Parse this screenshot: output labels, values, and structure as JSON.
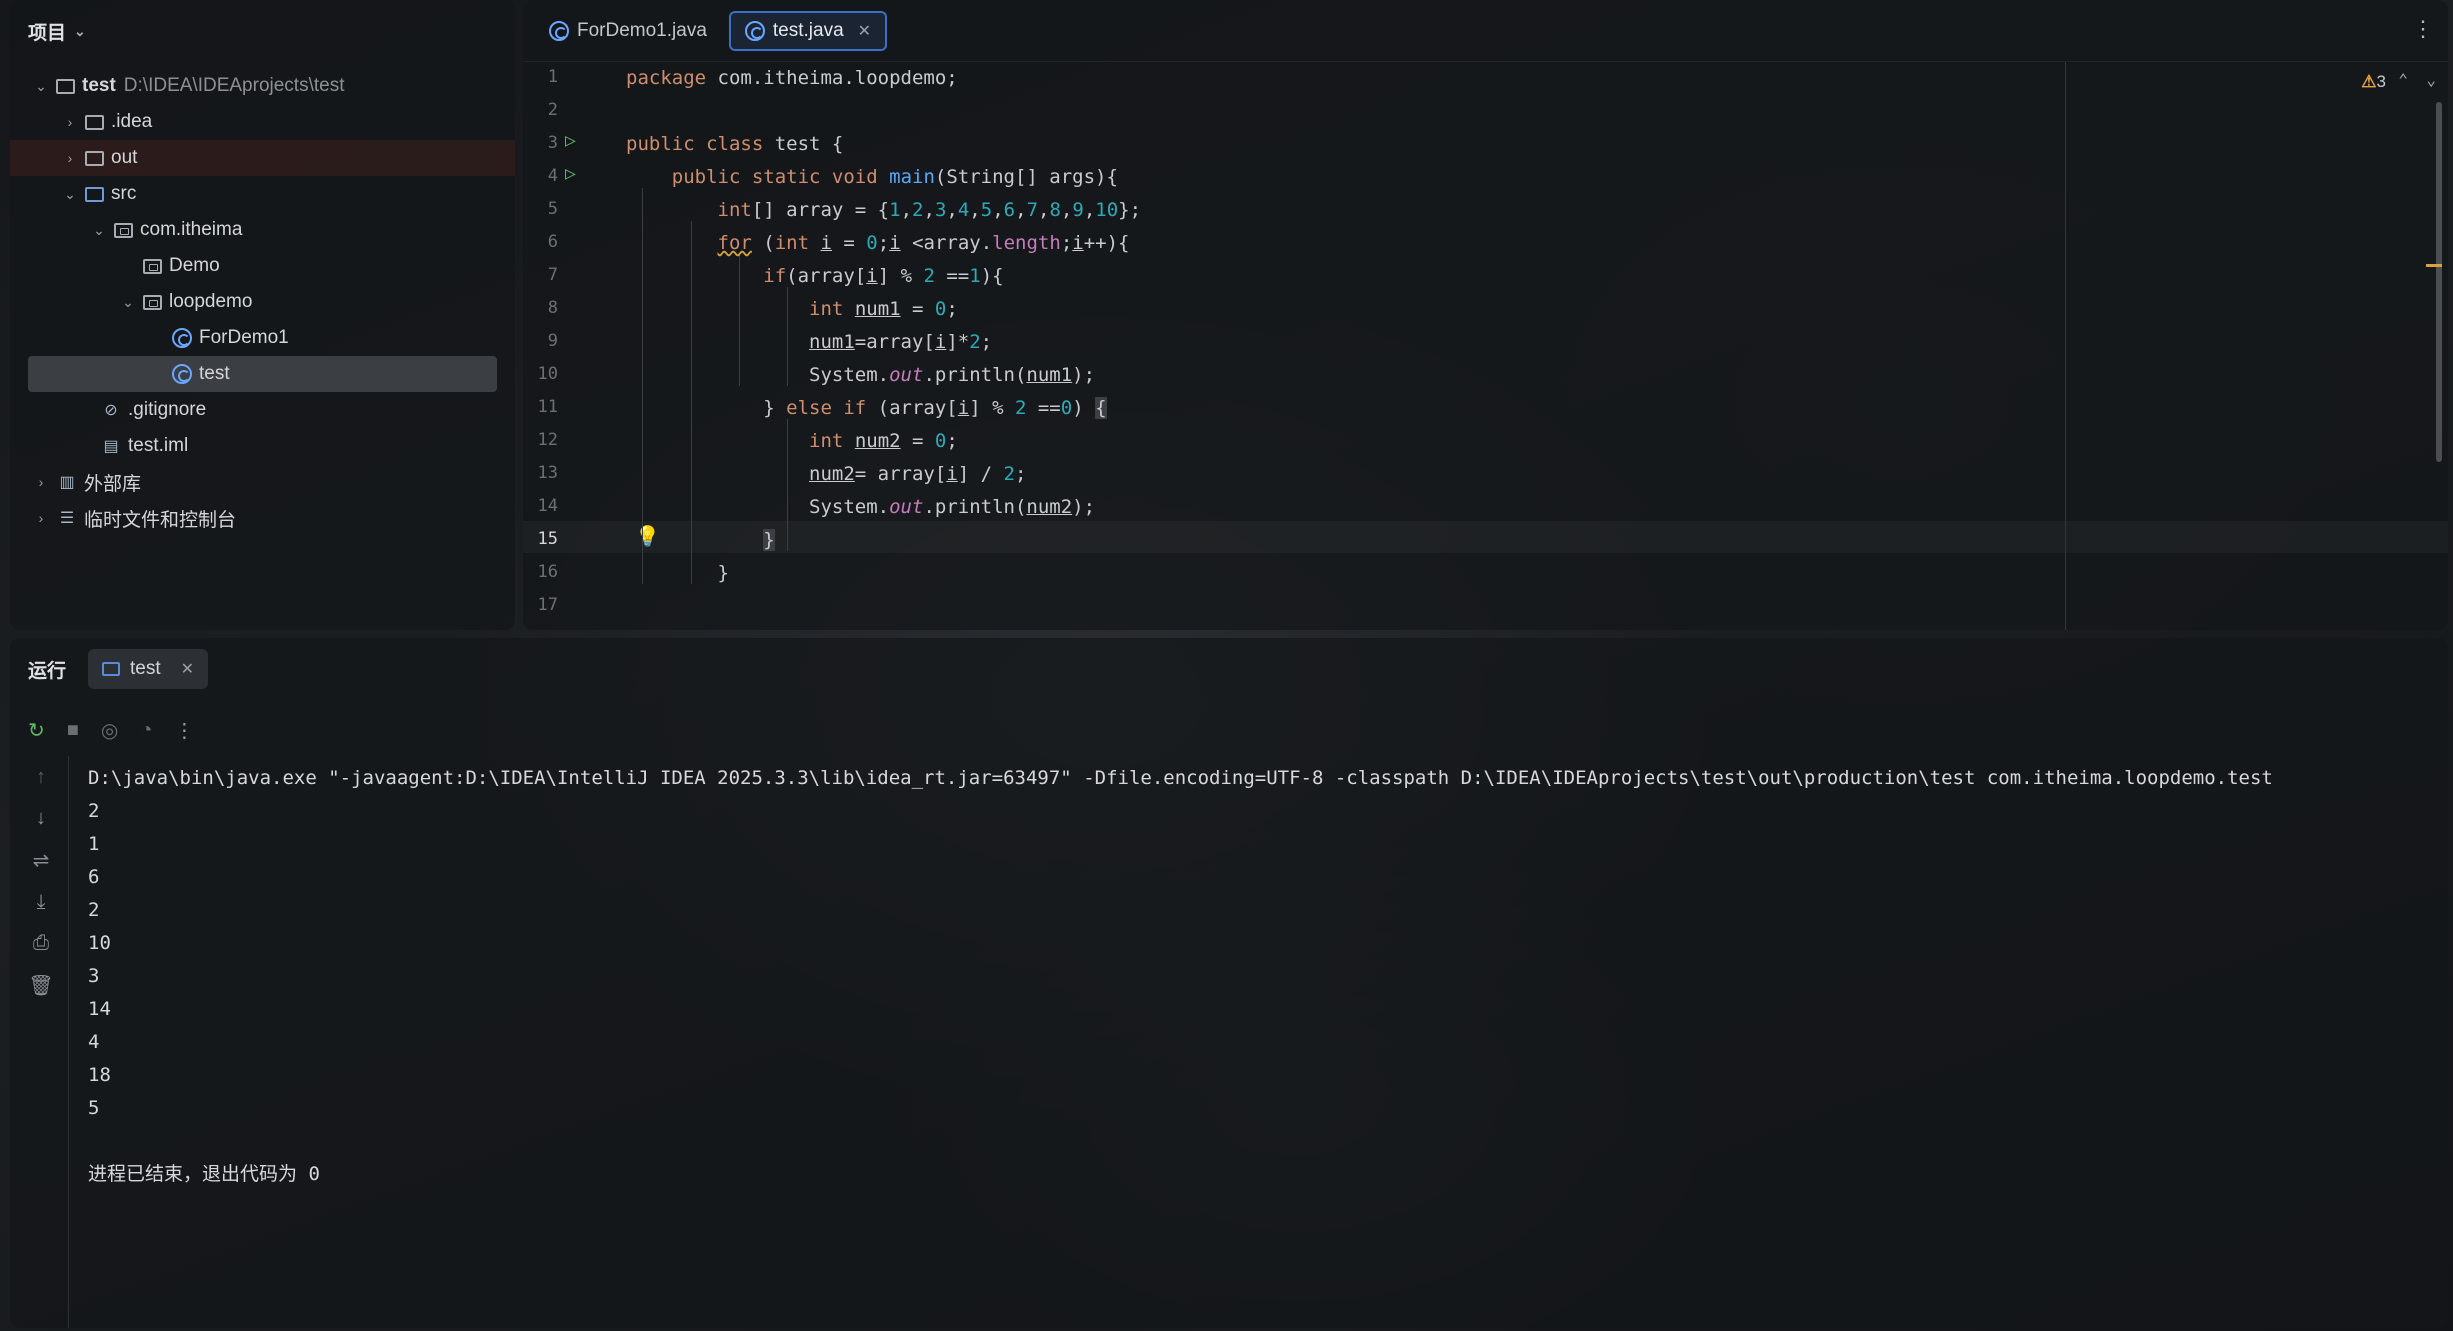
{
  "project": {
    "header": "项目",
    "tree": [
      {
        "label": "test",
        "path": "D:\\IDEA\\IDEAprojects\\test",
        "level": 0,
        "chevron": "down",
        "icon": "module-folder-icon"
      },
      {
        "label": ".idea",
        "level": 1,
        "chevron": "right",
        "icon": "folder-icon"
      },
      {
        "label": "out",
        "level": 1,
        "chevron": "right",
        "icon": "folder-icon"
      },
      {
        "label": "src",
        "level": 1,
        "chevron": "down",
        "icon": "source-folder-icon"
      },
      {
        "label": "com.itheima",
        "level": 2,
        "chevron": "down",
        "icon": "package-icon"
      },
      {
        "label": "Demo",
        "level": 3,
        "chevron": "",
        "icon": "package-icon"
      },
      {
        "label": "loopdemo",
        "level": 3,
        "chevron": "down",
        "icon": "package-icon"
      },
      {
        "label": "ForDemo1",
        "level": 4,
        "chevron": "",
        "icon": "java-class-icon"
      },
      {
        "label": "test",
        "level": 4,
        "chevron": "",
        "icon": "java-class-icon"
      },
      {
        "label": ".gitignore",
        "level": 1,
        "chevron": "",
        "icon": "gitignore-icon"
      },
      {
        "label": "test.iml",
        "level": 1,
        "chevron": "",
        "icon": "iml-file-icon"
      },
      {
        "label": "外部库",
        "level": 0,
        "chevron": "right",
        "icon": "library-icon"
      },
      {
        "label": "临时文件和控制台",
        "level": 0,
        "chevron": "right",
        "icon": "scratches-icon"
      }
    ]
  },
  "editor": {
    "tabs": [
      {
        "label": "ForDemo1.java",
        "active": false
      },
      {
        "label": "test.java",
        "active": true
      }
    ],
    "warnings_count": "3",
    "current_line": 15
  },
  "run": {
    "title": "运行",
    "tab_label": "test",
    "console": [
      "D:\\java\\bin\\java.exe \"-javaagent:D:\\IDEA\\IntelliJ IDEA 2025.3.3\\lib\\idea_rt.jar=63497\" -Dfile.encoding=UTF-8 -classpath D:\\IDEA\\IDEAprojects\\test\\out\\production\\test com.itheima.loopdemo.test",
      "2",
      "1",
      "6",
      "2",
      "10",
      "3",
      "14",
      "4",
      "18",
      "5",
      "",
      "进程已结束，退出代码为 0"
    ]
  }
}
